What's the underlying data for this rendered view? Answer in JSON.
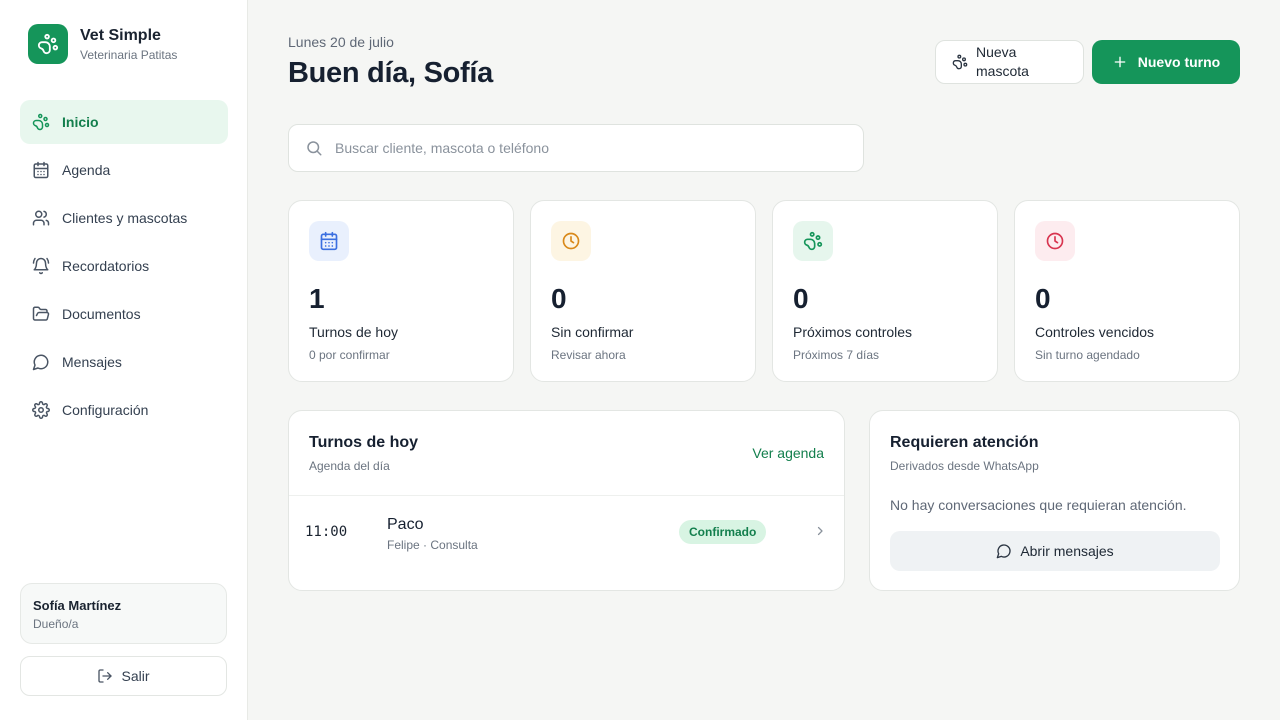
{
  "brand": {
    "name": "Vet Simple",
    "subtitle": "Veterinaria Patitas",
    "color": "#15955a"
  },
  "sidebar": {
    "items": [
      {
        "label": "Inicio",
        "icon": "paw-icon",
        "active": true
      },
      {
        "label": "Agenda",
        "icon": "calendar-icon"
      },
      {
        "label": "Clientes y mascotas",
        "icon": "users-icon"
      },
      {
        "label": "Recordatorios",
        "icon": "bell-icon"
      },
      {
        "label": "Documentos",
        "icon": "folder-icon"
      },
      {
        "label": "Mensajes",
        "icon": "message-icon"
      },
      {
        "label": "Configuración",
        "icon": "gear-icon"
      }
    ],
    "user": {
      "name": "Sofía Martínez",
      "role": "Dueño/a"
    },
    "logout_label": "Salir"
  },
  "header": {
    "date": "Lunes 20 de julio",
    "greeting": "Buen día, Sofía",
    "new_pet_label": "Nueva mascota",
    "new_appt_label": "Nuevo turno"
  },
  "search": {
    "placeholder": "Buscar cliente, mascota o teléfono",
    "value": ""
  },
  "stats": [
    {
      "value": "1",
      "label": "Turnos de hoy",
      "sub": "0 por confirmar",
      "icon": "calendar-icon",
      "color": "#3b6fe0",
      "bg": "#e9f0fd"
    },
    {
      "value": "0",
      "label": "Sin confirmar",
      "sub": "Revisar ahora",
      "icon": "clock-icon",
      "color": "#d9891a",
      "bg": "#fdf5e3"
    },
    {
      "value": "0",
      "label": "Próximos controles",
      "sub": "Próximos 7 días",
      "icon": "paw-icon",
      "color": "#15955a",
      "bg": "#e6f6ed"
    },
    {
      "value": "0",
      "label": "Controles vencidos",
      "sub": "Sin turno agendado",
      "icon": "clock-icon",
      "color": "#d8344f",
      "bg": "#fdecef"
    }
  ],
  "today": {
    "title": "Turnos de hoy",
    "subtitle": "Agenda del día",
    "link_label": "Ver agenda",
    "appointments": [
      {
        "time": "11:00",
        "pet": "Paco",
        "detail": "Felipe · Consulta",
        "status": "Confirmado"
      }
    ]
  },
  "attention": {
    "title": "Requieren atención",
    "subtitle": "Derivados desde WhatsApp",
    "empty_text": "No hay conversaciones que requieran atención.",
    "button_label": "Abrir mensajes"
  }
}
